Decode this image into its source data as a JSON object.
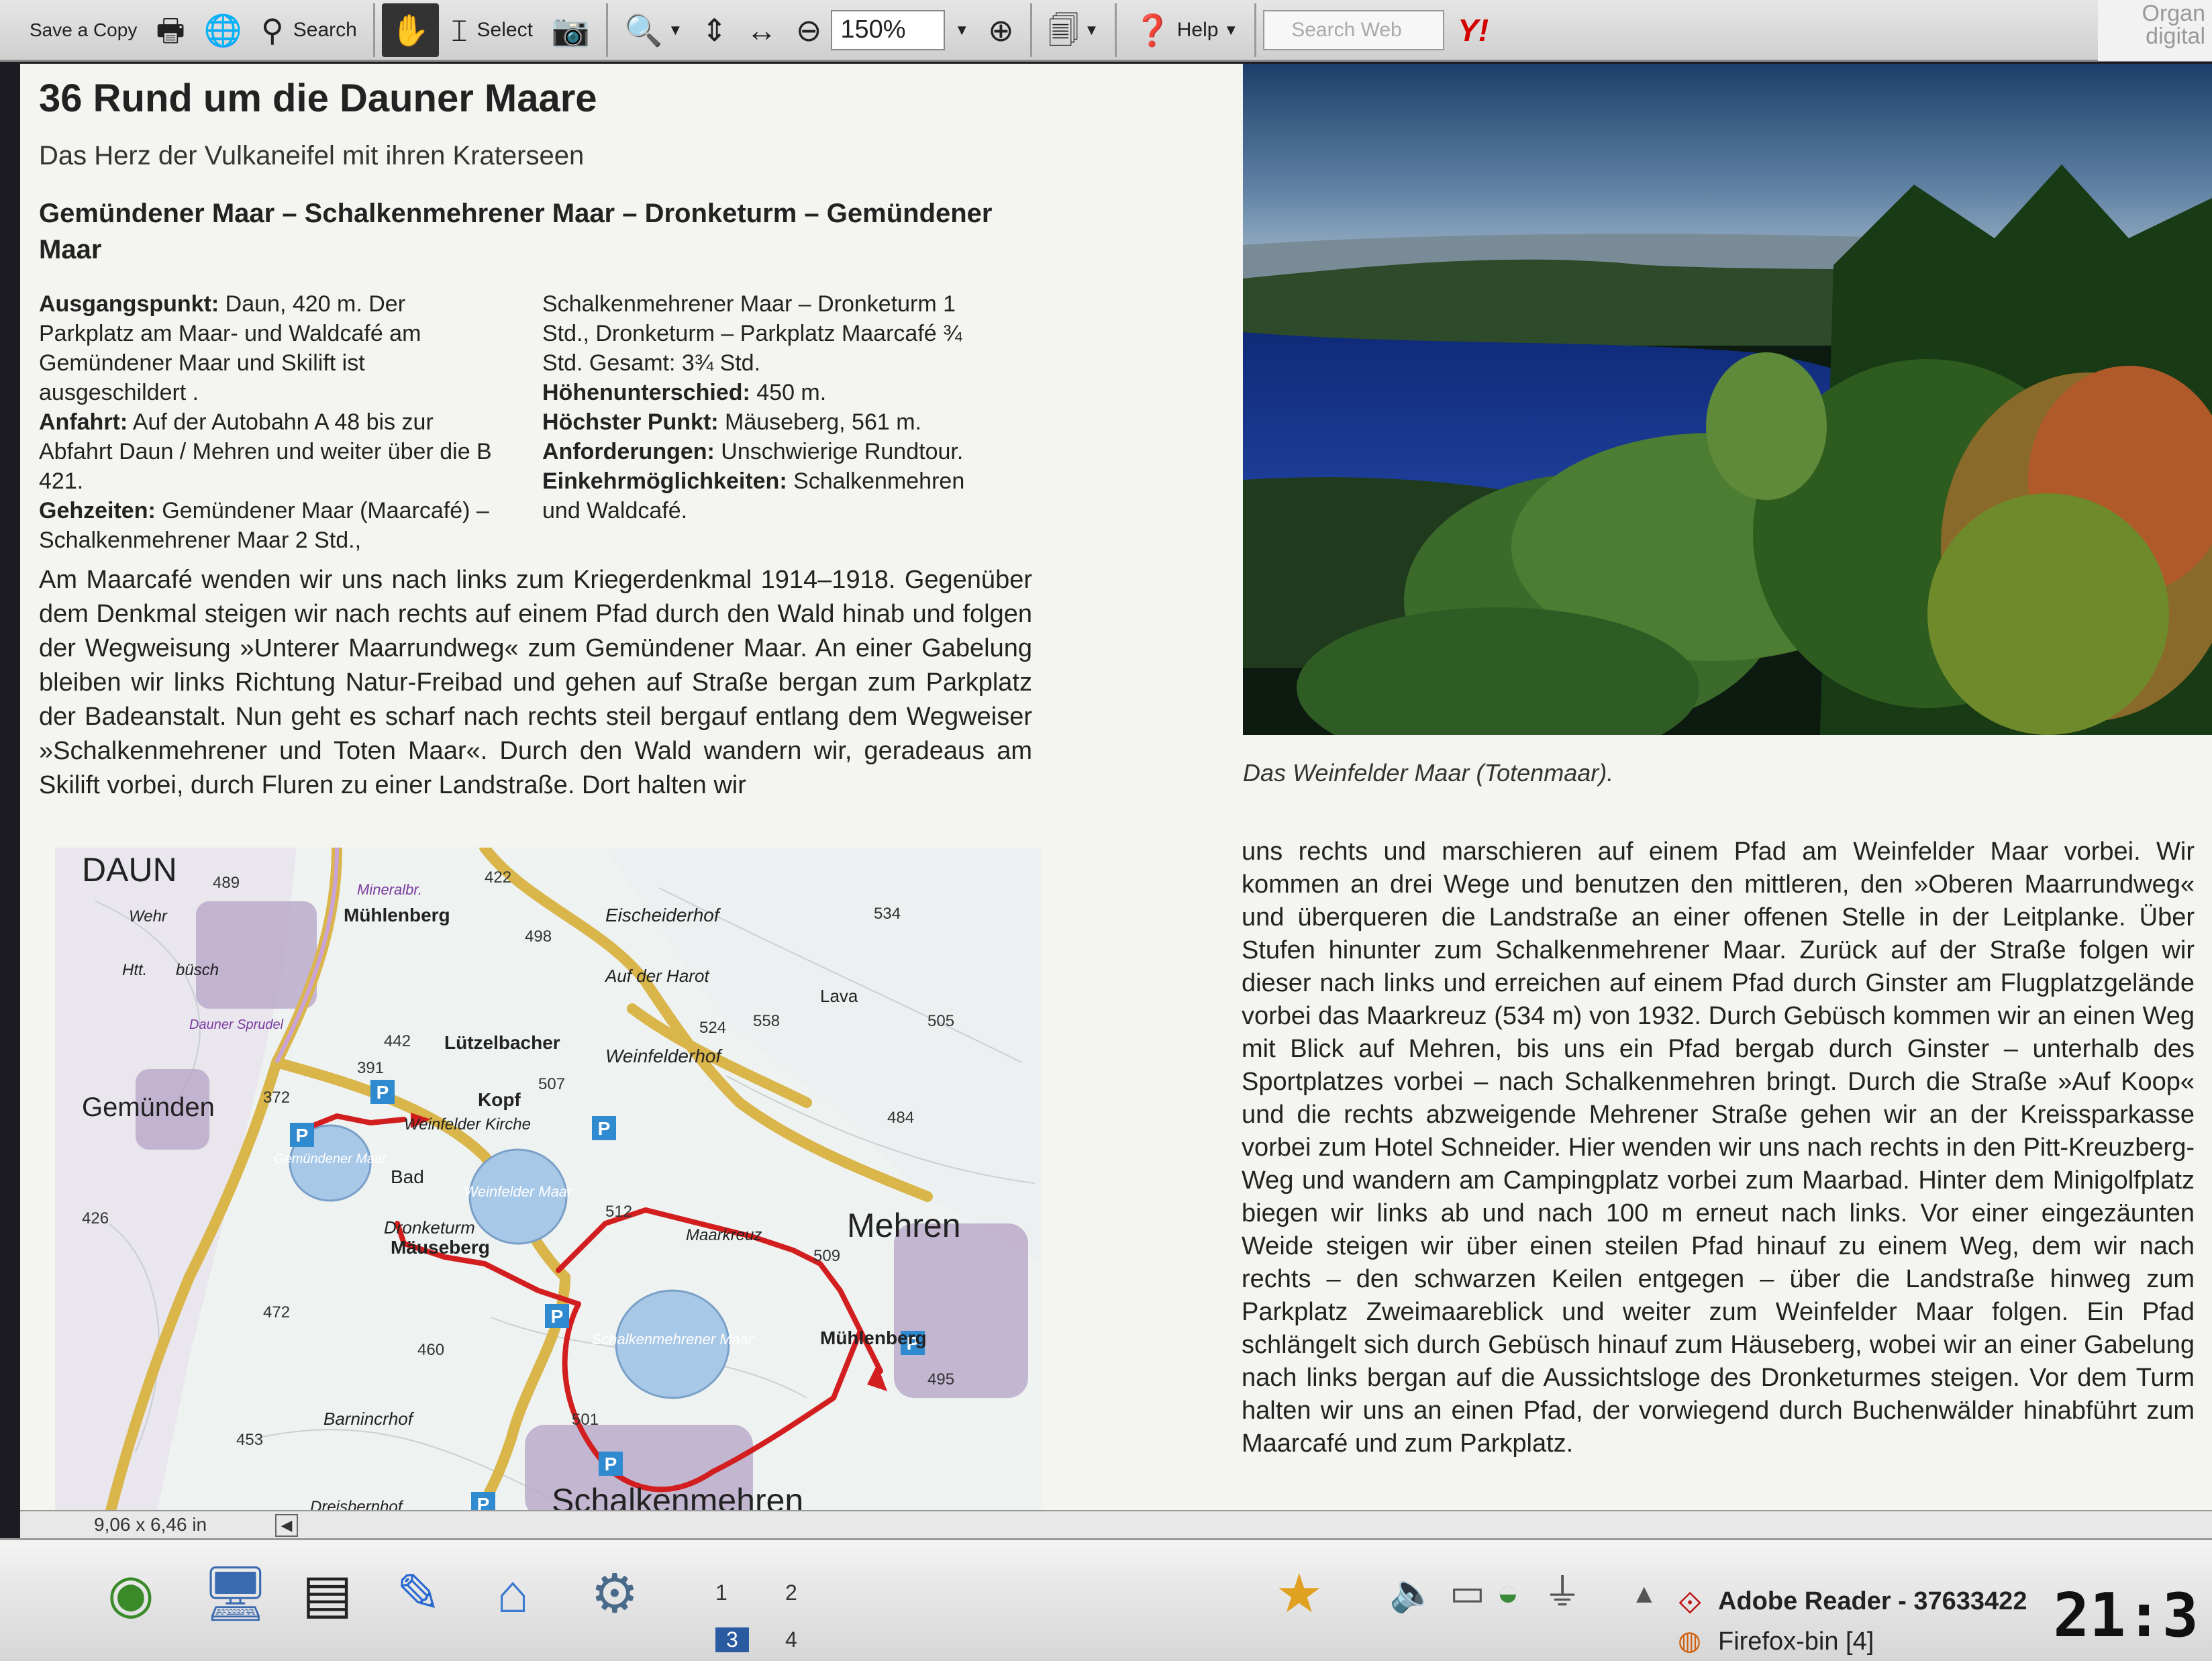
{
  "toolbar": {
    "save_copy": "Save a Copy",
    "search": "Search",
    "select": "Select",
    "zoom": "150%",
    "help": "Help",
    "search_web_placeholder": "Search Web",
    "yahoo": "Y!",
    "organize": "Organ digital"
  },
  "doc": {
    "title": "36 Rund um die Dauner Maare",
    "subtitle": "Das Herz der Vulkaneifel mit ihren Kraterseen",
    "route": "Gemündener Maar – Schalkenmehrener Maar – Dronketurm – Gemündener Maar",
    "info_left": [
      {
        "label": "Ausgangspunkt:",
        "text": " Daun, 420 m. Der Parkplatz am Maar- und Waldcafé am Gemündener Maar und Skilift ist ausgeschildert ."
      },
      {
        "label": "Anfahrt:",
        "text": " Auf der Autobahn A 48 bis zur Abfahrt Daun / Mehren und weiter über die B 421."
      },
      {
        "label": "Gehzeiten:",
        "text": " Gemündener Maar (Maarcafé) – Schalkenmehrener Maar 2 Std.,"
      }
    ],
    "info_right": [
      {
        "label": "",
        "text": "Schalkenmehrener Maar – Dronketurm 1 Std., Dronketurm – Parkplatz Maarcafé ¾ Std. Gesamt: 3¾ Std."
      },
      {
        "label": "Höhenunterschied:",
        "text": " 450 m."
      },
      {
        "label": "Höchster Punkt:",
        "text": " Mäuseberg, 561 m."
      },
      {
        "label": "Anforderungen:",
        "text": " Unschwierige Rundtour."
      },
      {
        "label": "Einkehrmöglichkeiten:",
        "text": " Schalkenmehren und Waldcafé."
      }
    ],
    "body_left": "Am Maarcafé wenden wir uns nach links zum Kriegerdenkmal 1914–1918. Gegenüber dem Denkmal steigen wir nach rechts auf einem Pfad durch den Wald hinab und folgen der Wegweisung »Unterer Maarrundweg« zum Gemündener Maar. An einer Gabelung bleiben wir links Richtung Natur-Freibad und gehen auf Straße bergan zum Parkplatz der Badeanstalt. Nun geht es scharf nach rechts steil bergauf entlang dem Wegweiser »Schalkenmehrener und Toten Maar«. Durch den Wald wandern wir, geradeaus am Skilift vorbei, durch Fluren zu einer Landstraße. Dort halten wir",
    "caption": "Das Weinfelder Maar (Totenmaar).",
    "body_right": "uns rechts und marschieren auf einem Pfad am Weinfelder Maar vorbei. Wir kommen an drei Wege und benutzen den mittleren, den »Oberen Maarrundweg« und überqueren die Landstraße an einer offenen Stelle in der Leitplanke. Über Stufen hinunter zum Schalkenmehrener Maar. Zurück auf der Straße folgen wir dieser nach links und erreichen auf einem Pfad durch Ginster am Flugplatzgelände vorbei das Maarkreuz (534 m) von 1932. Durch Gebüsch kommen wir an einen Weg mit Blick auf Mehren, bis uns ein Pfad bergab durch Ginster – unterhalb des Sportplatzes vorbei – nach Schalkenmehren bringt. Durch die Straße »Auf Koop« und die rechts abzweigende Mehrener Straße gehen wir an der Kreissparkasse vorbei zum Hotel Schneider. Hier wenden wir uns nach rechts in den Pitt-Kreuzberg-Weg und wandern am Campingplatz vorbei zum Maarbad. Hinter dem Minigolfplatz biegen wir links ab und nach 100 m erneut nach links. Vor einer eingezäunten Weide steigen wir über einen steilen Pfad hinauf zu einem Weg, dem wir nach rechts – den schwarzen Keilen entgegen – über die Landstraße hinweg zum Parkplatz Zweimaareblick und weiter zum Weinfelder Maar folgen. Ein Pfad schlängelt sich durch Gebüsch hinauf zum Häuseberg, wobei wir an einer Gabelung nach links bergan auf die Aussichtsloge des Dronketurmes steigen. Vor dem Turm halten wir uns an einen Pfad, der vorwiegend durch Buchenwälder hinabführt zum Maarcafé und zum Parkplatz."
  },
  "map_labels": {
    "daun": "DAUN",
    "gemuenden": "Gemünden",
    "mehren": "Mehren",
    "schalkenmehren": "Schalkenmehren",
    "muehlenberg_top": "Mühlenberg",
    "muehlenberg_right": "Mühlenberg",
    "eischeiderhof": "Eischeiderhof",
    "auf_der_harot": "Auf der Harot",
    "luetzelbacher": "Lützelbacher",
    "kopf": "Kopf",
    "weinfelderhof": "Weinfelderhof",
    "weinfelder_kirche": "Weinfelder Kirche",
    "weinfelder_maar": "Weinfelder Maar",
    "gemuendener_maar": "Gemündener Maar",
    "schalkenmehrener_maar": "Schalkenmehrener Maar",
    "dronketurm": "Dronketurm",
    "maeuseberg": "Mäuseberg",
    "maarkreuz": "Maarkreuz",
    "bad": "Bad",
    "lava": "Lava",
    "barnincrhof": "Barnincrhof",
    "dreisbernhof": "Dreisbernhof",
    "mineralbr": "Mineralbr.",
    "dauner_sprudel": "Dauner Sprudel",
    "wehr": "Wehr",
    "htt": "Htt.",
    "busch": "büsch",
    "elevations": [
      "489",
      "422",
      "498",
      "534",
      "558",
      "524",
      "505",
      "442",
      "391",
      "372",
      "507",
      "484",
      "512",
      "509",
      "426",
      "472",
      "460",
      "453",
      "501",
      "495"
    ]
  },
  "status": {
    "page_size": "9,06 x 6,46 in"
  },
  "taskbar": {
    "pager": [
      "1",
      "2",
      "3",
      "4"
    ],
    "adobe_reader": "Adobe Reader - 37633422",
    "firefox": "Firefox-bin [4]",
    "clock": "21:3"
  }
}
